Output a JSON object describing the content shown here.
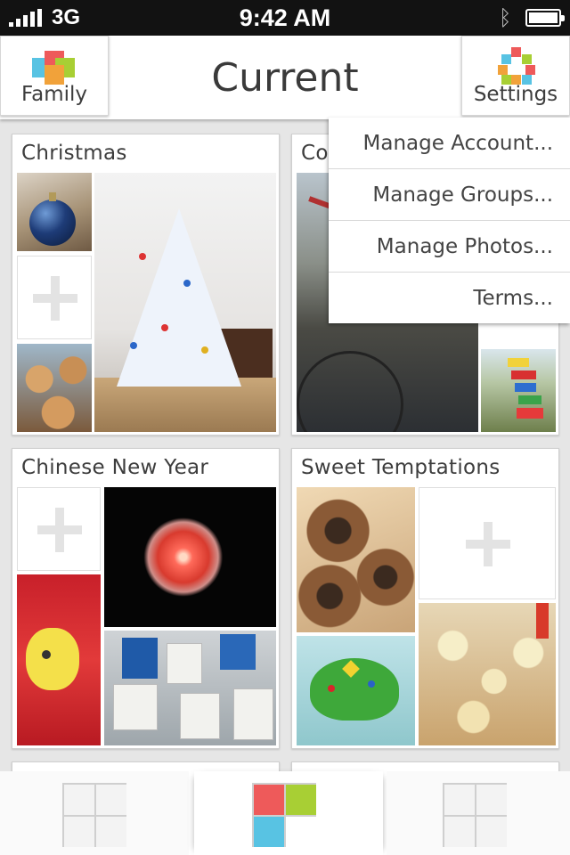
{
  "status_bar": {
    "carrier": "3G",
    "time": "9:42 AM"
  },
  "header": {
    "title": "Current",
    "left_button": {
      "label": "Family",
      "icon": "family-icon"
    },
    "right_button": {
      "label": "Settings",
      "icon": "settings-icon"
    }
  },
  "albums": [
    {
      "title": "Christmas"
    },
    {
      "title": "Co"
    },
    {
      "title": "Chinese New Year"
    },
    {
      "title": "Sweet Temptations"
    }
  ],
  "menu": {
    "items": [
      "Manage Account...",
      "Manage Groups...",
      "Manage Photos...",
      "Terms..."
    ]
  },
  "tabbar": {
    "tabs": [
      {
        "icon": "grid-icon",
        "active": false
      },
      {
        "icon": "color-grid-icon",
        "active": true
      },
      {
        "icon": "grid-icon",
        "active": false
      }
    ]
  },
  "colors": {
    "red": "#ee5a5a",
    "green": "#a8cf34",
    "blue": "#58c3e3",
    "orange": "#f1a23a",
    "title_text": "#3a3a3a"
  }
}
